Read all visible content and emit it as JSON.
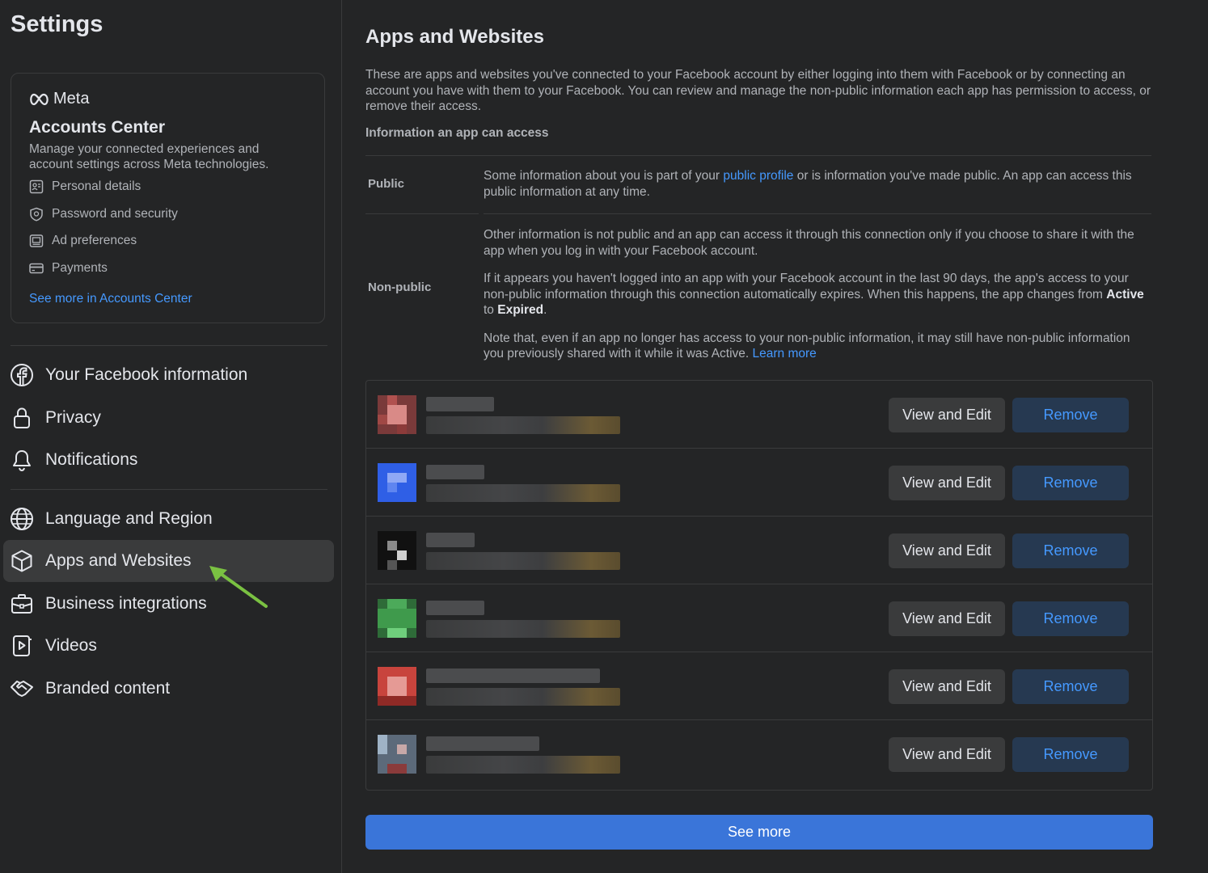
{
  "sidebar": {
    "title": "Settings",
    "accounts_center": {
      "brand": "Meta",
      "title": "Accounts Center",
      "description": "Manage your connected experiences and account settings across Meta technologies.",
      "items": [
        {
          "label": "Personal details",
          "icon": "id-card-icon"
        },
        {
          "label": "Password and security",
          "icon": "shield-icon"
        },
        {
          "label": "Ad preferences",
          "icon": "monitor-icon"
        },
        {
          "label": "Payments",
          "icon": "credit-card-icon"
        }
      ],
      "link": "See more in Accounts Center"
    },
    "nav": [
      {
        "label": "Your Facebook information",
        "icon": "facebook-icon",
        "active": false
      },
      {
        "label": "Privacy",
        "icon": "lock-icon",
        "active": false
      },
      {
        "label": "Notifications",
        "icon": "bell-icon",
        "active": false
      },
      {
        "label": "Language and Region",
        "icon": "globe-icon",
        "active": false
      },
      {
        "label": "Apps and Websites",
        "icon": "cube-icon",
        "active": true
      },
      {
        "label": "Business integrations",
        "icon": "briefcase-icon",
        "active": false
      },
      {
        "label": "Videos",
        "icon": "video-icon",
        "active": false
      },
      {
        "label": "Branded content",
        "icon": "handshake-icon",
        "active": false
      }
    ]
  },
  "main": {
    "title": "Apps and Websites",
    "intro": "These are apps and websites you've connected to your Facebook account by either logging into them with Facebook or by connecting an account you have with them to your Facebook. You can review and manage the non-public information each app has permission to access, or remove their access.",
    "info_heading": "Information an app can access",
    "public": {
      "label": "Public",
      "text_before": "Some information about you is part of your ",
      "link": "public profile",
      "text_after": " or is information you've made public. An app can access this public information at any time."
    },
    "non_public": {
      "label": "Non-public",
      "para1": "Other information is not public and an app can access it through this connection only if you choose to share it with the app when you log in with your Facebook account.",
      "para2_before": "If it appears you haven't logged into an app with your Facebook account in the last 90 days, the app's access to your non-public information through this connection automatically expires. When this happens, the app changes from ",
      "para2_active": "Active",
      "para2_mid": " to ",
      "para2_expired": "Expired",
      "para2_end": ".",
      "para3_before": "Note that, even if an app no longer has access to your non-public information, it may still have non-public information you previously shared with it while it was Active. ",
      "para3_link": "Learn more"
    },
    "apps": [
      {
        "icon_color": "#c0605c",
        "view_label": "View and Edit",
        "remove_label": "Remove"
      },
      {
        "icon_color": "#2f5fe6",
        "view_label": "View and Edit",
        "remove_label": "Remove"
      },
      {
        "icon_color": "#1a1a1a",
        "view_label": "View and Edit",
        "remove_label": "Remove"
      },
      {
        "icon_color": "#3f9a4c",
        "view_label": "View and Edit",
        "remove_label": "Remove"
      },
      {
        "icon_color": "#c8443d",
        "view_label": "View and Edit",
        "remove_label": "Remove"
      },
      {
        "icon_color": "#7d8ea0",
        "view_label": "View and Edit",
        "remove_label": "Remove"
      }
    ],
    "see_more": "See more"
  },
  "colors": {
    "background": "#242526",
    "link": "#4599ff",
    "primary_button": "#3a75d9",
    "remove_button_bg": "#263951",
    "annotation_arrow": "#7ac142"
  }
}
